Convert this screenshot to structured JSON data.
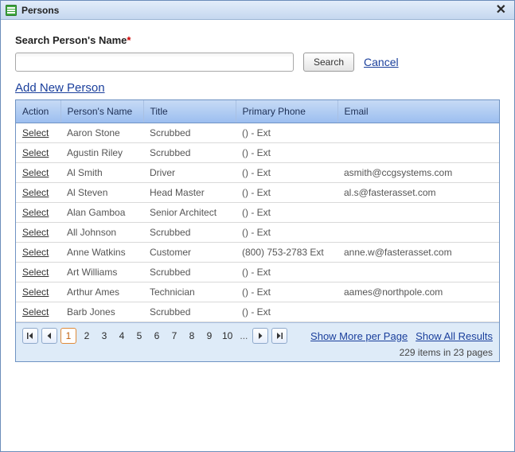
{
  "window": {
    "title": "Persons"
  },
  "search": {
    "label": "Search Person's Name",
    "required_marker": "*",
    "input_value": "",
    "button_label": "Search",
    "cancel_label": "Cancel"
  },
  "actions": {
    "add_new_label": "Add New Person",
    "select_label": "Select"
  },
  "grid": {
    "columns": {
      "action": "Action",
      "name": "Person's Name",
      "title": "Title",
      "phone": "Primary Phone",
      "email": "Email"
    },
    "rows": [
      {
        "name": "Aaron Stone",
        "title": "Scrubbed",
        "phone": "() - Ext",
        "email": ""
      },
      {
        "name": "Agustin Riley",
        "title": "Scrubbed",
        "phone": "() - Ext",
        "email": ""
      },
      {
        "name": "Al Smith",
        "title": "Driver",
        "phone": "() - Ext",
        "email": "asmith@ccgsystems.com"
      },
      {
        "name": "Al Steven",
        "title": "Head Master",
        "phone": "() - Ext",
        "email": "al.s@fasterasset.com"
      },
      {
        "name": "Alan Gamboa",
        "title": "Senior Architect",
        "phone": "() - Ext",
        "email": ""
      },
      {
        "name": "All Johnson",
        "title": "Scrubbed",
        "phone": "() - Ext",
        "email": ""
      },
      {
        "name": "Anne Watkins",
        "title": "Customer",
        "phone": "(800) 753-2783 Ext",
        "email": "anne.w@fasterasset.com"
      },
      {
        "name": "Art Williams",
        "title": "Scrubbed",
        "phone": "() - Ext",
        "email": ""
      },
      {
        "name": "Arthur Ames",
        "title": "Technician",
        "phone": "() - Ext",
        "email": "aames@northpole.com"
      },
      {
        "name": "Barb Jones",
        "title": "Scrubbed",
        "phone": "() - Ext",
        "email": ""
      }
    ]
  },
  "pager": {
    "current_page": 1,
    "pages_visible": [
      "1",
      "2",
      "3",
      "4",
      "5",
      "6",
      "7",
      "8",
      "9",
      "10"
    ],
    "ellipsis": "...",
    "show_more_label": "Show More per Page",
    "show_all_label": "Show All Results",
    "summary": "229 items in 23 pages"
  }
}
